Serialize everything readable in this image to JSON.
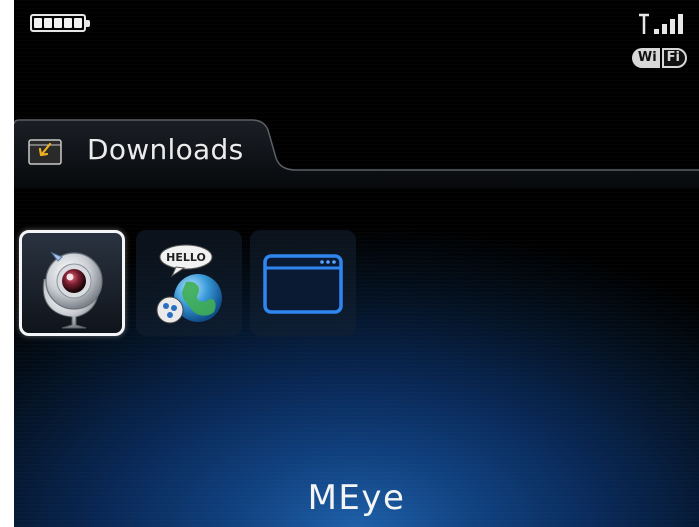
{
  "status_bar": {
    "battery_icon": "battery-full-icon",
    "signal_icon": "signal-bars-icon",
    "wifi_badge": {
      "left": "Wi",
      "right": "Fi"
    }
  },
  "folder": {
    "title": "Downloads",
    "icon": "folder-download-icon"
  },
  "apps": [
    {
      "name": "MEye",
      "icon": "webcam-icon",
      "selected": true
    },
    {
      "name": "",
      "icon": "hello-globe-icon",
      "selected": false
    },
    {
      "name": "",
      "icon": "browser-window-icon",
      "selected": false
    }
  ],
  "selected_app_label": "MEye",
  "colors": {
    "accent_blue": "#1e6fd9",
    "background_glow": "#1d5fa8"
  }
}
